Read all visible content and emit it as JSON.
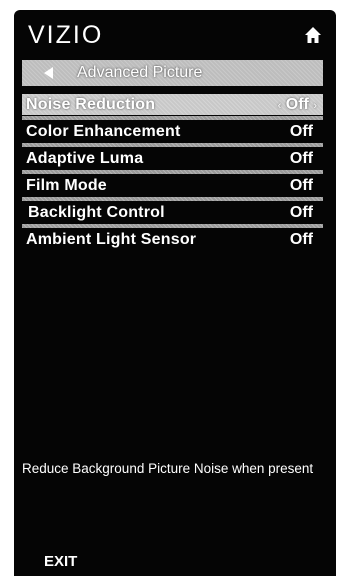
{
  "header": {
    "brand": "VIZIO",
    "home_icon": "home-icon"
  },
  "breadcrumb": {
    "back_icon": "back-arrow-icon",
    "title": "Advanced Picture"
  },
  "menu": {
    "items": [
      {
        "label": "Noise Reduction",
        "value": "Off",
        "selected": true
      },
      {
        "label": "Color Enhancement",
        "value": "Off",
        "selected": false
      },
      {
        "label": "Adaptive Luma",
        "value": "Off",
        "selected": false
      },
      {
        "label": "Film Mode",
        "value": "Off",
        "selected": false
      },
      {
        "label": "Backlight Control",
        "value": "Off",
        "selected": false
      },
      {
        "label": "Ambient Light Sensor",
        "value": "Off",
        "selected": false
      }
    ],
    "value_arrow_left": "‹",
    "value_arrow_right": "›"
  },
  "description": "Reduce Background Picture Noise when present",
  "footer": {
    "exit_label": "EXIT"
  },
  "colors": {
    "panel_background": "#050505",
    "highlight": "#c8c8c8",
    "text": "#ffffff"
  }
}
